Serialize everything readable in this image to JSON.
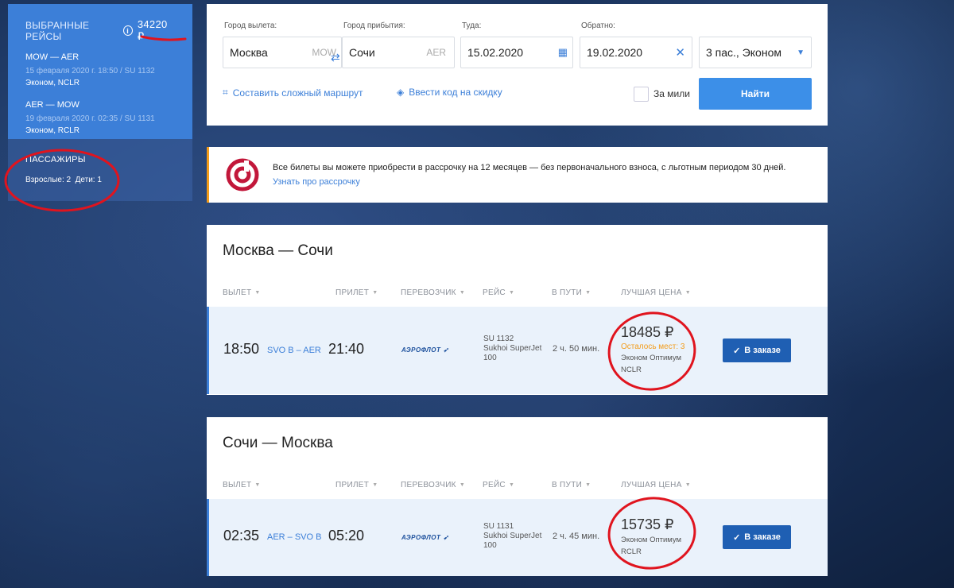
{
  "sidebar": {
    "title": "ВЫБРАННЫЕ РЕЙСЫ",
    "total_price": "34220 ₽",
    "flights": [
      {
        "route": "MOW — AER",
        "datetime": "15 февраля 2020 г. 18:50 / SU 1132",
        "class": "Эконом, NCLR"
      },
      {
        "route": "AER — MOW",
        "datetime": "19 февраля 2020 г. 02:35 / SU 1131",
        "class": "Эконом, RCLR"
      }
    ],
    "passengers_title": "ПАССАЖИРЫ",
    "passengers_info": "Взрослые: 2  Дети: 1"
  },
  "search": {
    "from_label": "Город вылета:",
    "from_value": "Москва",
    "from_code": "MOW",
    "to_label": "Город прибытия:",
    "to_value": "Сочи",
    "to_code": "AER",
    "depart_label": "Туда:",
    "depart_value": "15.02.2020",
    "return_label": "Обратно:",
    "return_value": "19.02.2020",
    "passengers_value": "3 пас., Эконом",
    "complex_route_link": "Составить сложный маршрут",
    "promo_link": "Ввести код на скидку",
    "miles_label": "За мили",
    "find_button": "Найти"
  },
  "banner": {
    "text": "Все билеты вы можете приобрести в рассрочку на 12 месяцев — без первоначального взноса, с льготным периодом 30 дней.",
    "link": "Узнать про рассрочку"
  },
  "columns": {
    "departure": "ВЫЛЕТ",
    "arrival": "ПРИЛЕТ",
    "carrier": "ПЕРЕВОЗЧИК",
    "flight": "РЕЙС",
    "duration": "В ПУТИ",
    "best_price": "ЛУЧШАЯ ЦЕНА"
  },
  "outbound": {
    "title": "Москва — Сочи",
    "dep_time": "18:50",
    "route": "SVO B – AER",
    "arr_time": "21:40",
    "carrier": "АЭРОФЛОТ",
    "flight_no": "SU 1132",
    "aircraft": "Sukhoi SuperJet 100",
    "duration": "2 ч. 50 мин.",
    "price": "18485 ₽",
    "seats_left": "Осталось мест: 3",
    "fare": "Эконом Оптимум",
    "fare_code": "NCLR",
    "order_button": "В заказе"
  },
  "inbound": {
    "title": "Сочи — Москва",
    "dep_time": "02:35",
    "route": "AER – SVO B",
    "arr_time": "05:20",
    "carrier": "АЭРОФЛОТ",
    "flight_no": "SU 1131",
    "aircraft": "Sukhoi SuperJet 100",
    "duration": "2 ч. 45 мин.",
    "price": "15735 ₽",
    "fare": "Эконом Оптимум",
    "fare_code": "RCLR",
    "order_button": "В заказе"
  },
  "colors": {
    "accent": "#3c7fd8",
    "annotation": "#e0141e",
    "warning": "#f39c1a"
  }
}
